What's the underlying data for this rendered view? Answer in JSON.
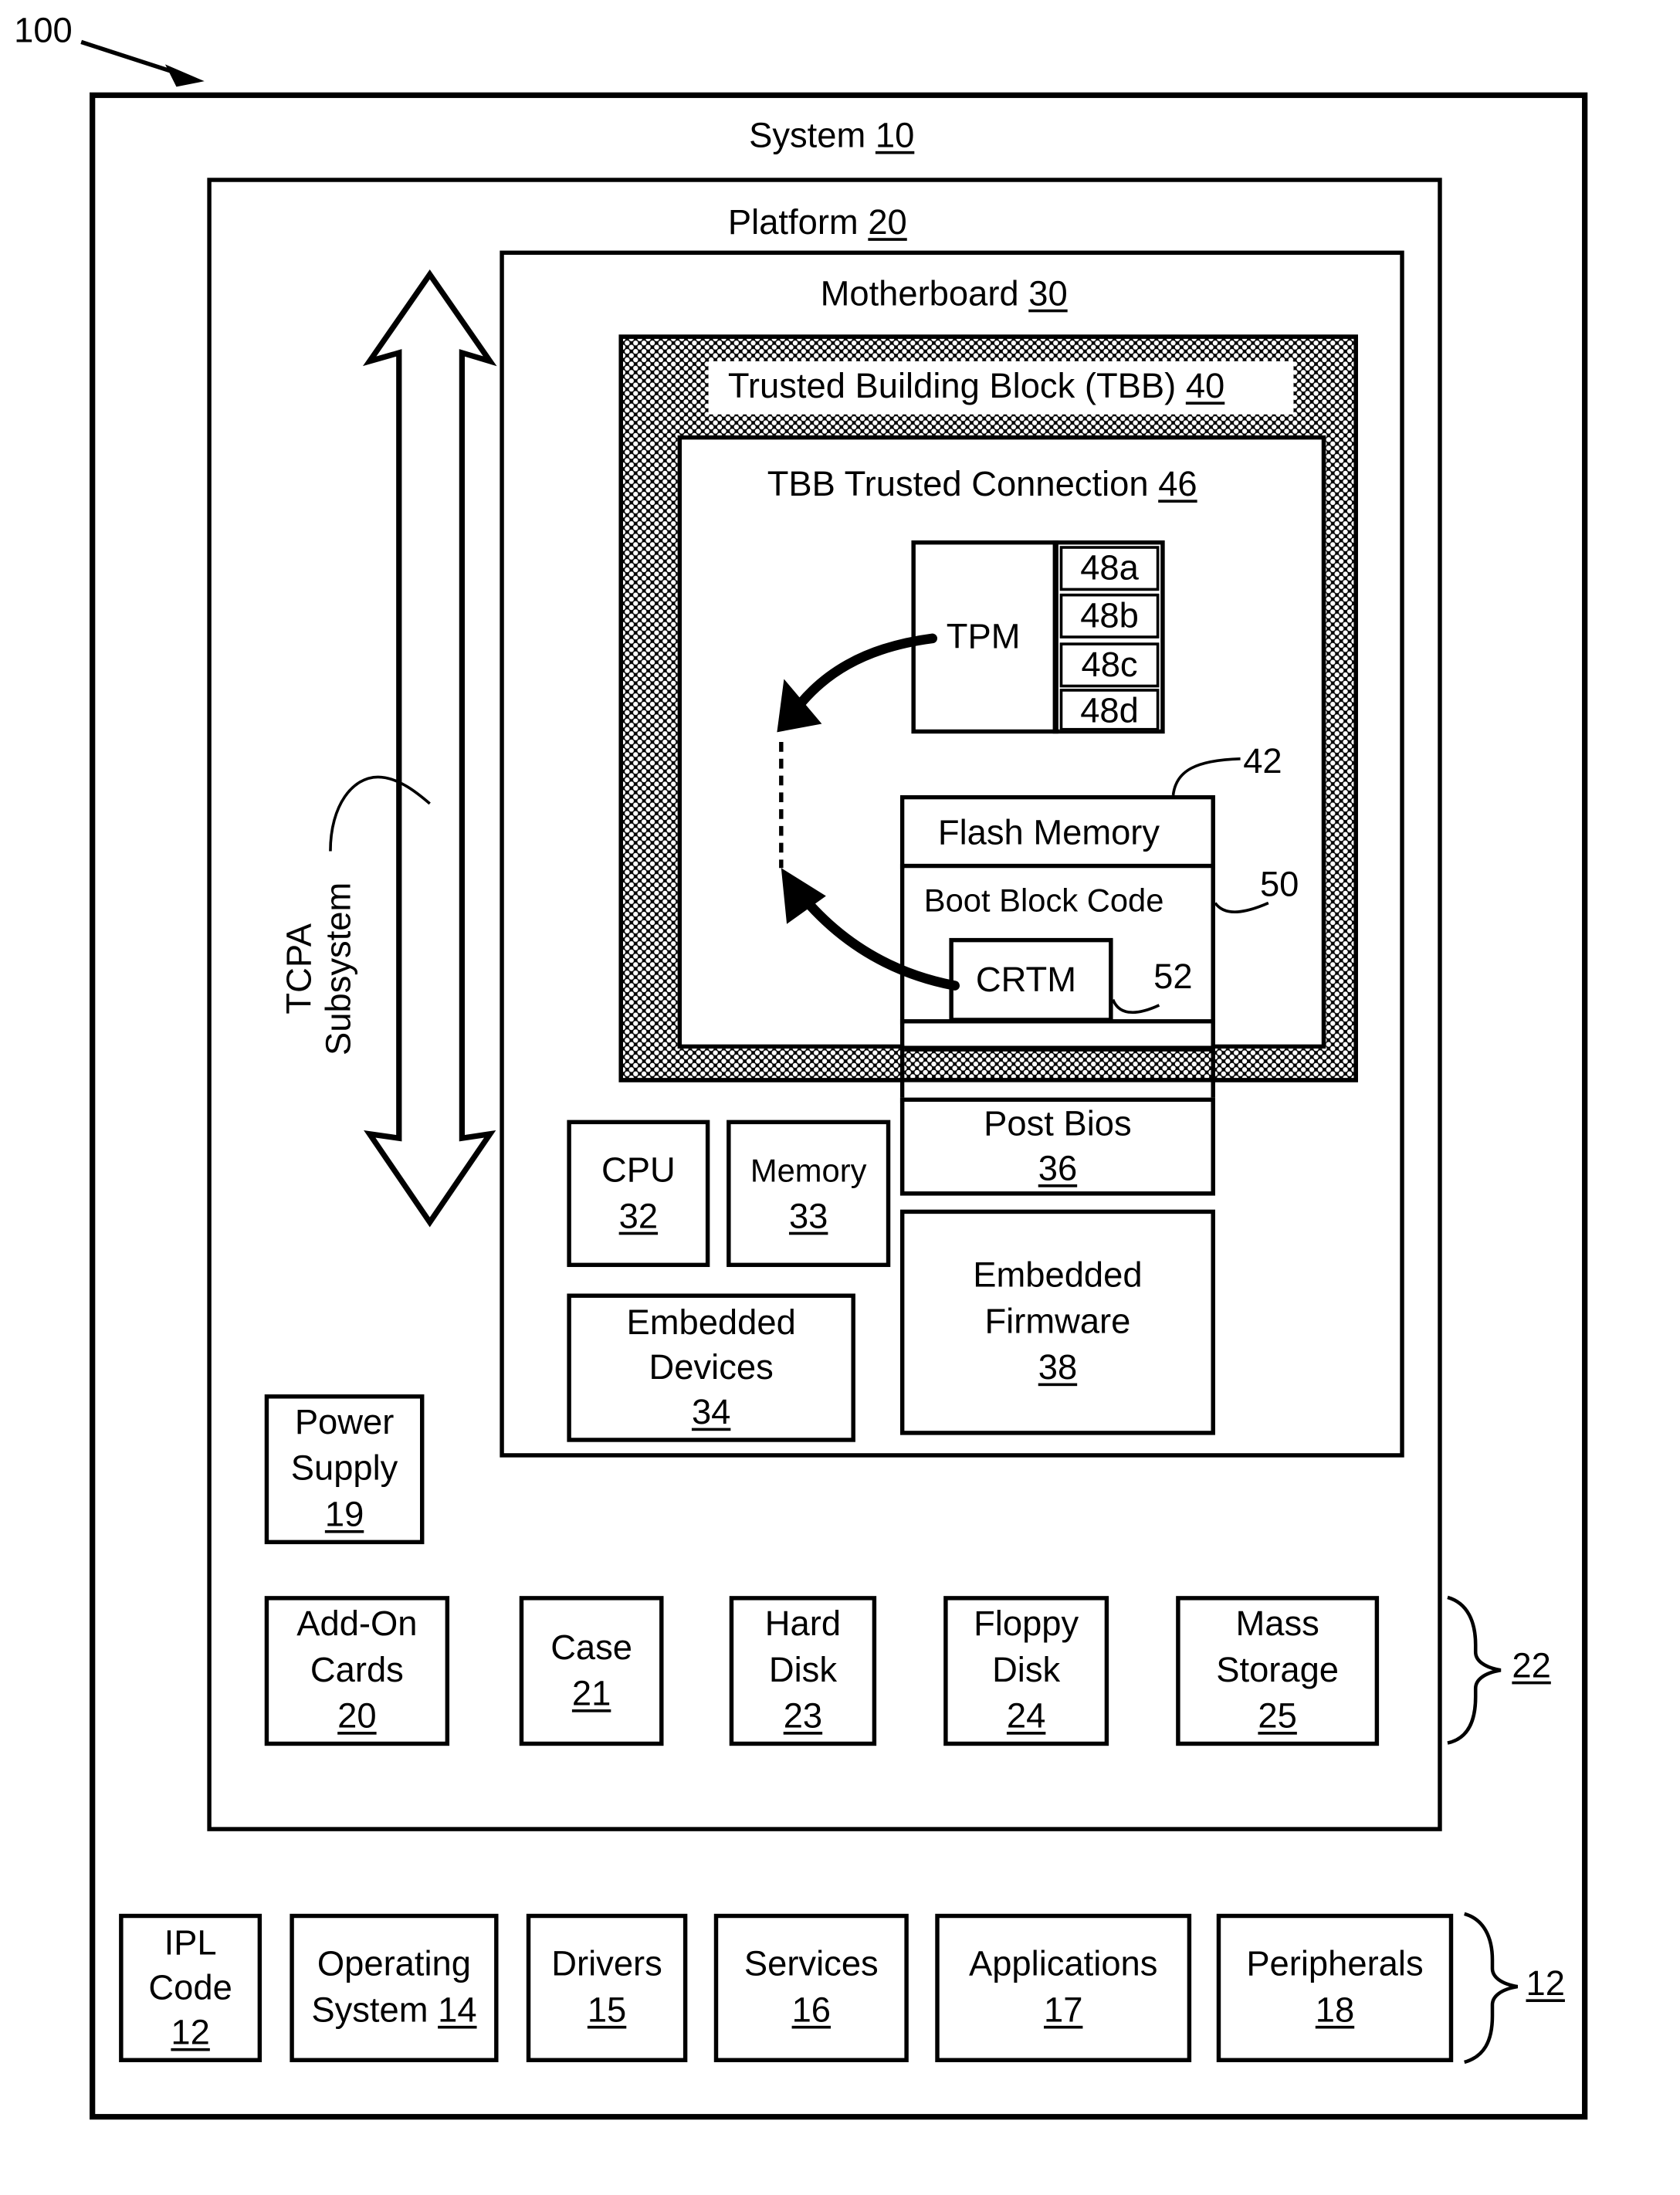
{
  "figure_ref": "100",
  "system": {
    "label": "System",
    "ref": "10"
  },
  "platform": {
    "label": "Platform",
    "ref": "20"
  },
  "motherboard": {
    "label": "Motherboard",
    "ref": "30"
  },
  "tbb": {
    "label": "Trusted Building Block (TBB)",
    "ref": "40",
    "connection": {
      "label": "TBB Trusted Connection",
      "ref": "46"
    }
  },
  "tpm": {
    "label": "TPM",
    "registers": [
      "48a",
      "48b",
      "48c",
      "48d"
    ]
  },
  "flash": {
    "ref": "42",
    "label": "Flash Memory",
    "boot_block": {
      "label": "Boot Block Code",
      "ref": "50"
    },
    "crtm": {
      "label": "CRTM",
      "ref": "52"
    }
  },
  "tcpa": {
    "line1": "TCPA",
    "line2": "Subsystem"
  },
  "motherboard_components": [
    {
      "name": "cpu",
      "lines": [
        "CPU"
      ],
      "ref": "32"
    },
    {
      "name": "memory",
      "lines": [
        "Memory"
      ],
      "ref": "33"
    },
    {
      "name": "post-bios",
      "lines": [
        "Post Bios"
      ],
      "ref": "36"
    },
    {
      "name": "embedded-devices",
      "lines": [
        "Embedded",
        "Devices"
      ],
      "ref": "34"
    },
    {
      "name": "embedded-firmware",
      "lines": [
        "Embedded",
        "Firmware"
      ],
      "ref": "38"
    }
  ],
  "power_supply": {
    "lines": [
      "Power",
      "Supply"
    ],
    "ref": "19"
  },
  "platform_components": {
    "group_ref": "22",
    "items": [
      {
        "name": "add-on-cards",
        "lines": [
          "Add-On",
          "Cards"
        ],
        "ref": "20"
      },
      {
        "name": "case",
        "lines": [
          "Case"
        ],
        "ref": "21"
      },
      {
        "name": "hard-disk",
        "lines": [
          "Hard",
          "Disk"
        ],
        "ref": "23"
      },
      {
        "name": "floppy-disk",
        "lines": [
          "Floppy",
          "Disk"
        ],
        "ref": "24"
      },
      {
        "name": "mass-storage",
        "lines": [
          "Mass",
          "Storage"
        ],
        "ref": "25"
      }
    ]
  },
  "software_components": {
    "group_ref": "12",
    "items": [
      {
        "name": "ipl-code",
        "lines": [
          "IPL",
          "Code"
        ],
        "ref": "12"
      },
      {
        "name": "operating-system",
        "lines": [
          "Operating",
          "System"
        ],
        "ref": "14",
        "inline_ref": true
      },
      {
        "name": "drivers",
        "lines": [
          "Drivers"
        ],
        "ref": "15"
      },
      {
        "name": "services",
        "lines": [
          "Services"
        ],
        "ref": "16"
      },
      {
        "name": "applications",
        "lines": [
          "Applications"
        ],
        "ref": "17"
      },
      {
        "name": "peripherals",
        "lines": [
          "Peripherals"
        ],
        "ref": "18"
      }
    ]
  }
}
